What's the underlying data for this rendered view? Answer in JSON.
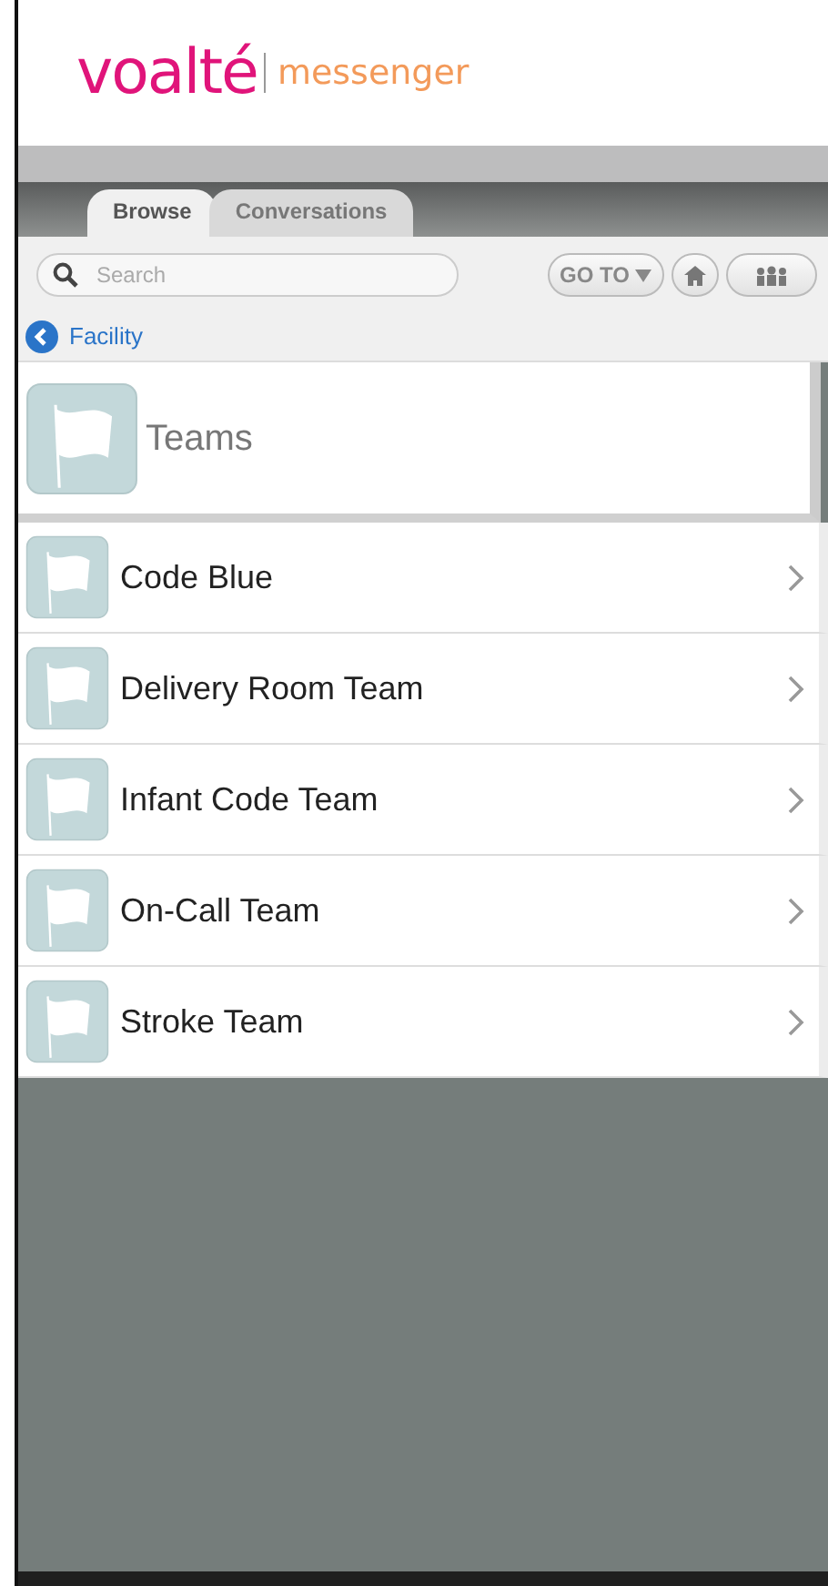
{
  "logo": {
    "brand": "voalté",
    "product": "messenger"
  },
  "tabs": [
    {
      "label": "Browse",
      "selected": true
    },
    {
      "label": "Conversations",
      "selected": false
    }
  ],
  "search": {
    "placeholder": "Search"
  },
  "goto_button": {
    "label": "GO TO"
  },
  "breadcrumb": {
    "label": "Facility"
  },
  "section": {
    "title": "Teams"
  },
  "items": [
    {
      "name": "Code Blue"
    },
    {
      "name": "Delivery Room Team"
    },
    {
      "name": "Infant Code Team"
    },
    {
      "name": "On-Call Team"
    },
    {
      "name": "Stroke Team"
    }
  ]
}
